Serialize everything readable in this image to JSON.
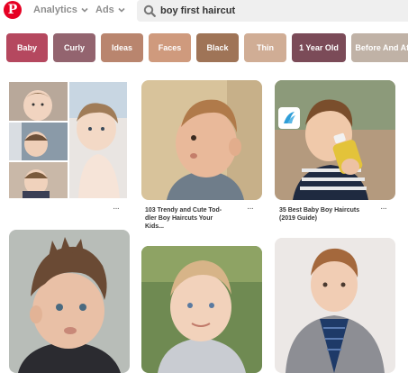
{
  "header": {
    "logo_letter": "P",
    "nav": {
      "analytics_label": "Analytics",
      "ads_label": "Ads"
    },
    "search": {
      "value": "boy first haircut"
    }
  },
  "chips": [
    {
      "label": "Baby",
      "color": "#b5485f"
    },
    {
      "label": "Curly",
      "color": "#93646f"
    },
    {
      "label": "Ideas",
      "color": "#b9856e"
    },
    {
      "label": "Faces",
      "color": "#cf9a7d"
    },
    {
      "label": "Black",
      "color": "#9f7457"
    },
    {
      "label": "Thin",
      "color": "#d0ad95"
    },
    {
      "label": "1 Year Old",
      "color": "#7b4b58"
    },
    {
      "label": "Before And After",
      "color": "#c0b2a6"
    }
  ],
  "pins": {
    "menu_glyph": "···",
    "pin2_caption_lines": [
      "103 Trendy and Cute Tod-",
      "dler Boy Haircuts Your",
      "Kids..."
    ],
    "pin3_caption_lines": [
      "35 Best Baby Boy Haircuts",
      "(2019 Guide)"
    ]
  }
}
